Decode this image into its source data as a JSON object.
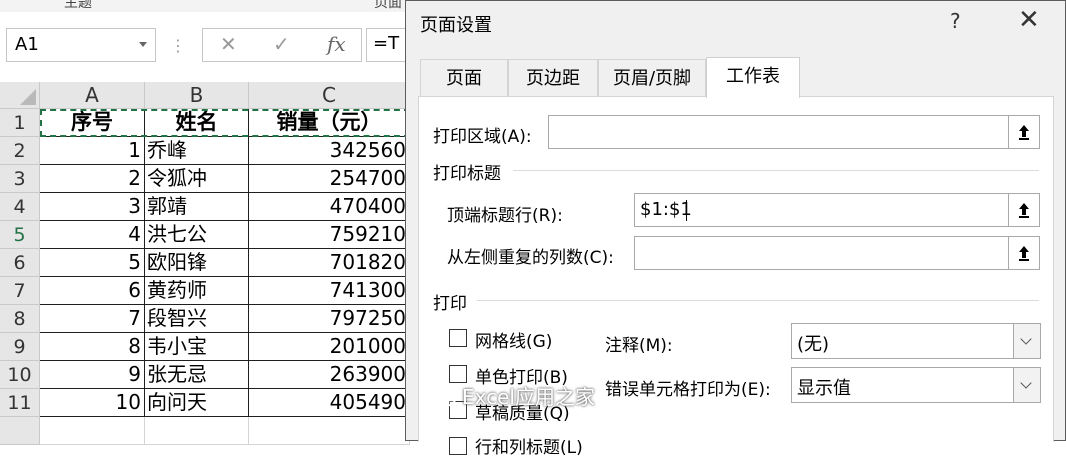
{
  "ribbon": {
    "left_label": "主题",
    "right_label": "页面"
  },
  "name_box": {
    "value": "A1"
  },
  "formula_bar": {
    "cancel_glyph": "✕",
    "enter_glyph": "✓",
    "fx_glyph": "fx",
    "value": "=T"
  },
  "columns": [
    "A",
    "B",
    "C"
  ],
  "rows": [
    {
      "num": "1",
      "a": "序号",
      "b": "姓名",
      "c": "销量（元）"
    },
    {
      "num": "2",
      "a": "1",
      "b": "乔峰",
      "c": "342560"
    },
    {
      "num": "3",
      "a": "2",
      "b": "令狐冲",
      "c": "254700"
    },
    {
      "num": "4",
      "a": "3",
      "b": "郭靖",
      "c": "470400"
    },
    {
      "num": "5",
      "a": "4",
      "b": "洪七公",
      "c": "759210"
    },
    {
      "num": "6",
      "a": "5",
      "b": "欧阳锋",
      "c": "701820"
    },
    {
      "num": "7",
      "a": "6",
      "b": "黄药师",
      "c": "741300"
    },
    {
      "num": "8",
      "a": "7",
      "b": "段智兴",
      "c": "797250"
    },
    {
      "num": "9",
      "a": "8",
      "b": "韦小宝",
      "c": "201000"
    },
    {
      "num": "10",
      "a": "9",
      "b": "张无忌",
      "c": "263900"
    },
    {
      "num": "11",
      "a": "10",
      "b": "向问天",
      "c": "405490"
    }
  ],
  "dialog": {
    "title": "页面设置",
    "help": "?",
    "close": "✕",
    "tabs": [
      "页面",
      "页边距",
      "页眉/页脚",
      "工作表"
    ],
    "active_tab": "工作表",
    "print_area_label": "打印区域(A):",
    "print_area_value": "",
    "print_titles_group": "打印标题",
    "top_rows_label": "顶端标题行(R):",
    "top_rows_value": "$1:$1",
    "left_cols_label": "从左侧重复的列数(C):",
    "left_cols_value": "",
    "print_group": "打印",
    "gridlines_label": "网格线(G)",
    "mono_label": "单色打印(B)",
    "draft_label": "草稿质量(Q)",
    "rowcol_label": "行和列标题(L)",
    "comments_label": "注释(M):",
    "comments_value": "(无)",
    "errors_label": "错误单元格打印为(E):",
    "errors_value": "显示值"
  },
  "watermark": "Excel应用之家",
  "colors": {
    "accent_green": "#217346",
    "dialog_bg": "#f0f0f0"
  }
}
